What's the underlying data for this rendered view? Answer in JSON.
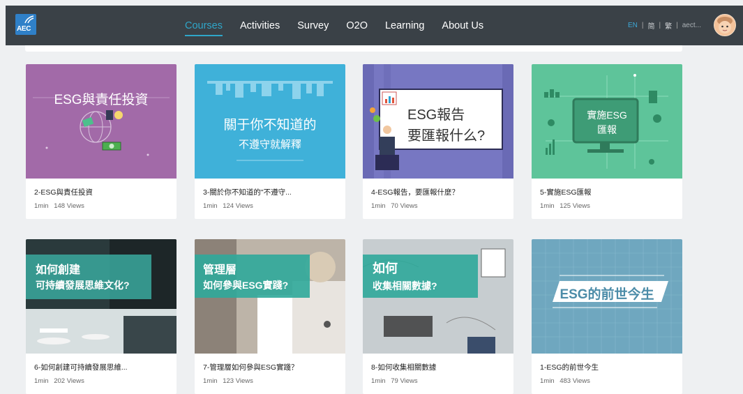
{
  "logo": {
    "text": "AEC"
  },
  "nav": {
    "items": [
      {
        "label": "Courses",
        "active": true
      },
      {
        "label": "Activities"
      },
      {
        "label": "Survey"
      },
      {
        "label": "O2O"
      },
      {
        "label": "Learning"
      },
      {
        "label": "About Us"
      }
    ],
    "languages": [
      "EN",
      "简",
      "繁"
    ],
    "user": "aect..."
  },
  "courses": [
    {
      "title": "2-ESG與責任投資",
      "duration": "1min",
      "views": "148 Views",
      "thumb_line1": "ESG與責任投資",
      "thumb_line2": "",
      "bg": "#a26aa8"
    },
    {
      "title": "3-關於你不知道的\"不遵守...",
      "duration": "1min",
      "views": "124 Views",
      "thumb_line1": "關于你不知道的",
      "thumb_line2": "不遵守就解釋",
      "bg": "#3fb1d9"
    },
    {
      "title": "4-ESG報告，要匯報什麼？",
      "duration": "1min",
      "views": "70 Views",
      "thumb_line1": "ESG報告",
      "thumb_line2": "要匯報什么?",
      "bg": "#7777c2"
    },
    {
      "title": "5-實施ESG匯報",
      "duration": "1min",
      "views": "125 Views",
      "thumb_line1": "實施ESG",
      "thumb_line2": "匯報",
      "bg": "#5ec49a"
    },
    {
      "title": "6-如何創建可持續發展思維...",
      "duration": "1min",
      "views": "202 Views",
      "thumb_line1": "如何創建",
      "thumb_line2": "可持續發展思維文化?",
      "bg": "#2a3a3c"
    },
    {
      "title": "7-管理層如何參與ESG實踐？",
      "duration": "1min",
      "views": "123 Views",
      "thumb_line1": "管理層",
      "thumb_line2": "如何參與ESG實踐?",
      "bg": "#bdb4a8"
    },
    {
      "title": "8-如何收集相關數據",
      "duration": "1min",
      "views": "79 Views",
      "thumb_line1": "如何",
      "thumb_line2": "收集相關數據?",
      "bg": "#c7cdd0"
    },
    {
      "title": "1-ESG的前世今生",
      "duration": "1min",
      "views": "483 Views",
      "thumb_line1": "ESG的前世今生",
      "thumb_line2": "",
      "bg": "#6fa7bf"
    }
  ]
}
